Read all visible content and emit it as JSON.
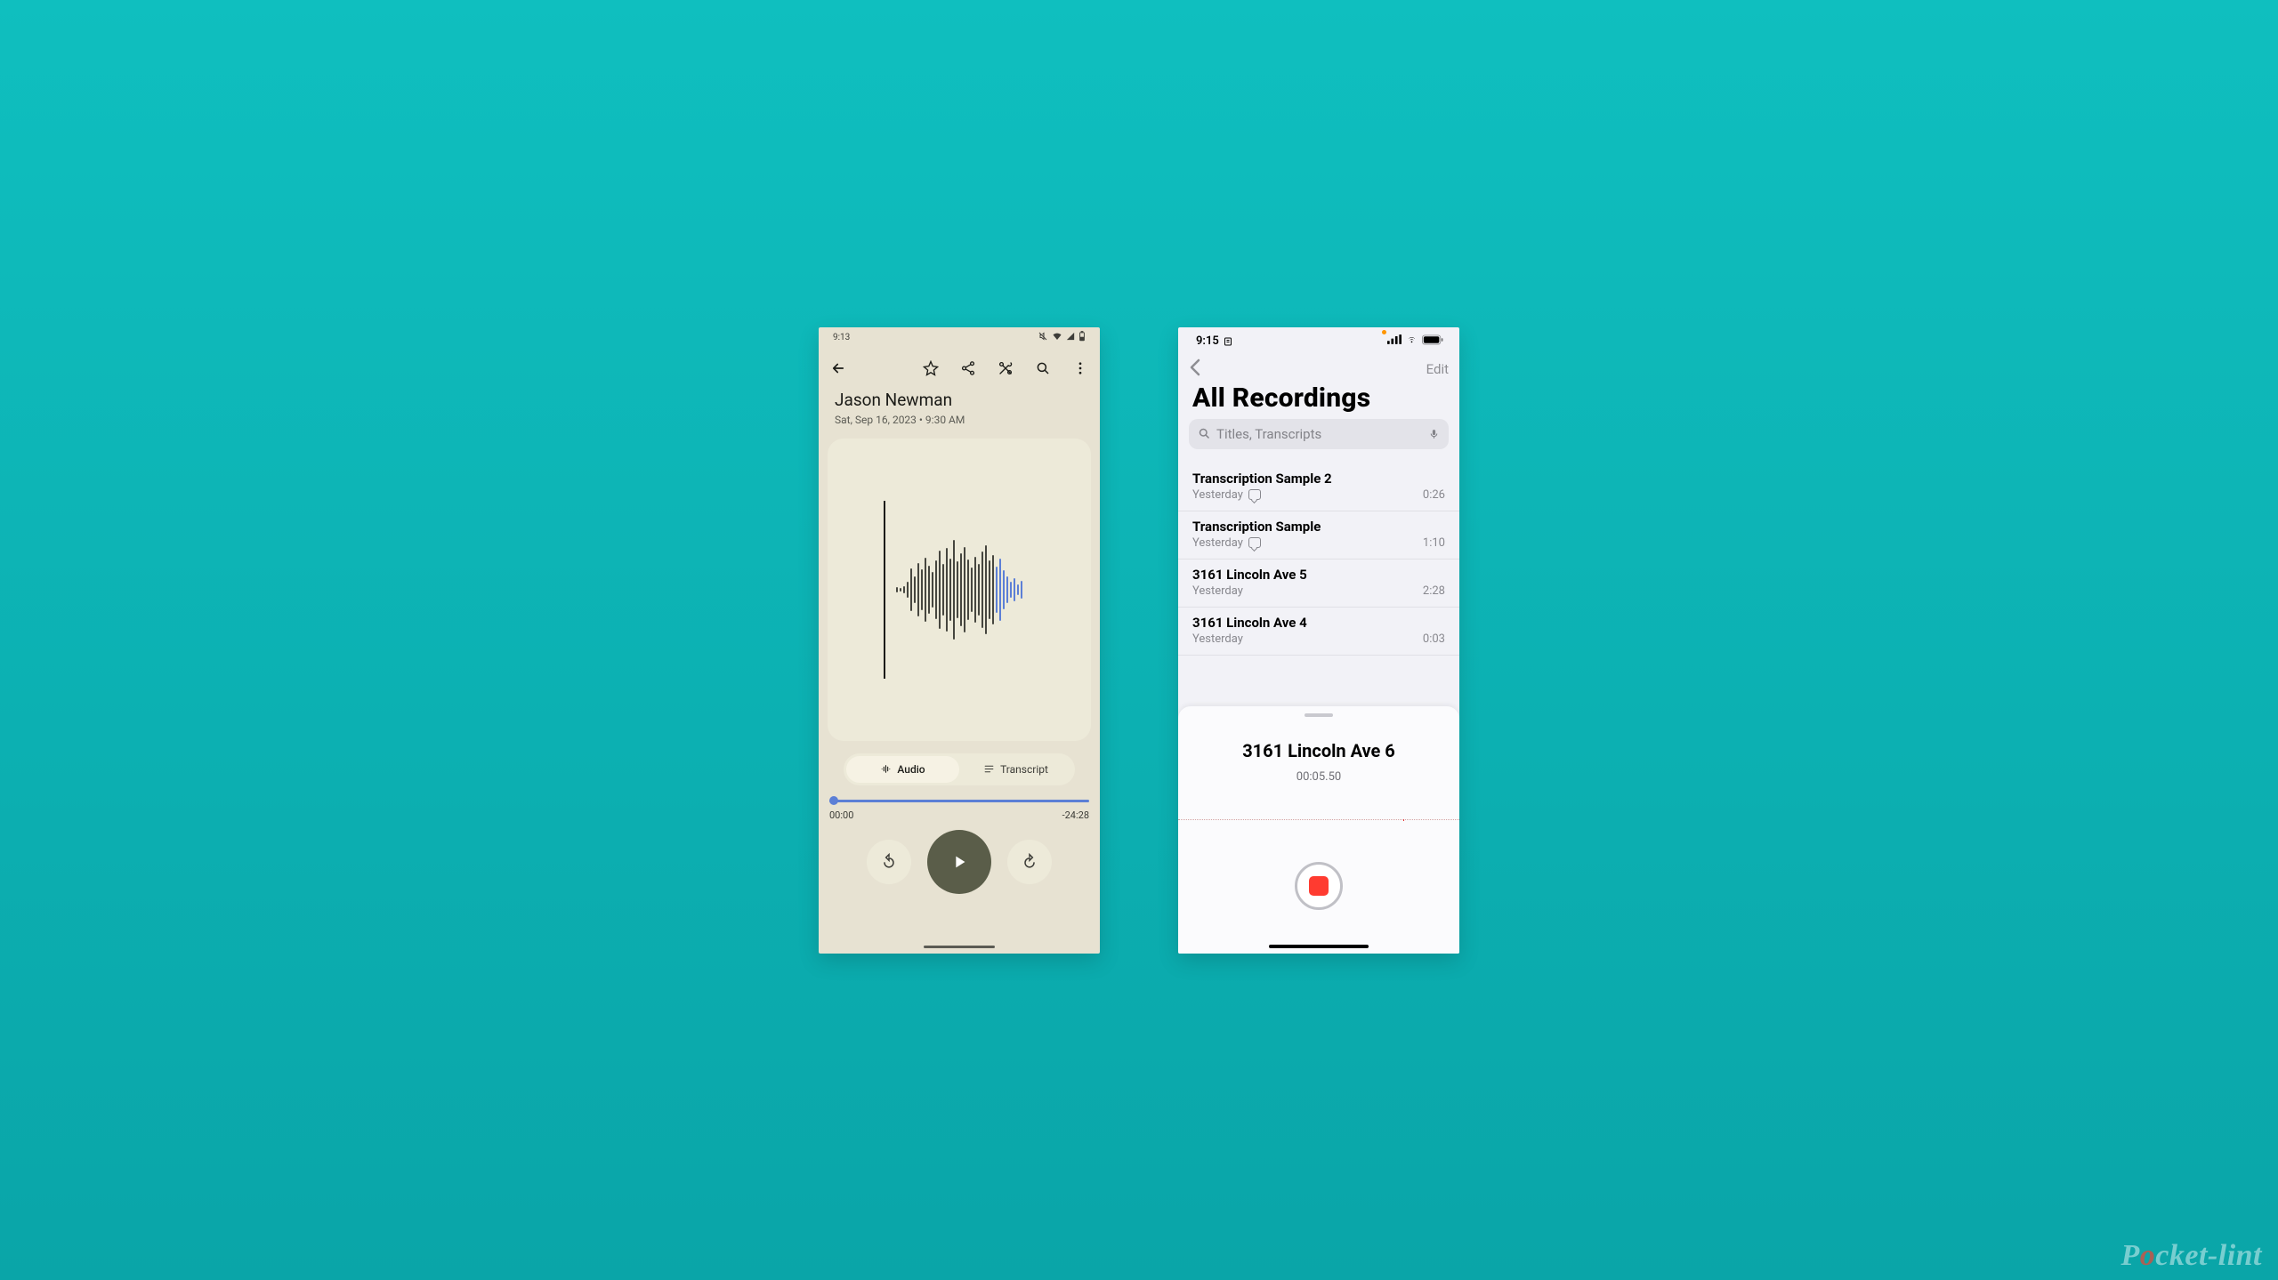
{
  "android": {
    "status": {
      "time": "9:13"
    },
    "title": "Jason Newman",
    "subtitle": "Sat, Sep 16, 2023 • 9:30 AM",
    "tabs": {
      "audio": "Audio",
      "transcript": "Transcript"
    },
    "seek": {
      "elapsed": "00:00",
      "remaining": "-24:28"
    }
  },
  "ios": {
    "status": {
      "time": "9:15"
    },
    "nav": {
      "edit": "Edit"
    },
    "heading": "All Recordings",
    "search_placeholder": "Titles, Transcripts",
    "recordings": [
      {
        "title": "Transcription Sample 2",
        "date": "Yesterday",
        "has_transcript": true,
        "duration": "0:26"
      },
      {
        "title": "Transcription Sample",
        "date": "Yesterday",
        "has_transcript": true,
        "duration": "1:10"
      },
      {
        "title": "3161 Lincoln Ave 5",
        "date": "Yesterday",
        "has_transcript": false,
        "duration": "2:28"
      },
      {
        "title": "3161 Lincoln Ave 4",
        "date": "Yesterday",
        "has_transcript": false,
        "duration": "0:03"
      }
    ],
    "sheet": {
      "title": "3161 Lincoln Ave 6",
      "time": "00:05.50"
    }
  },
  "watermark": "Pocket-lint"
}
